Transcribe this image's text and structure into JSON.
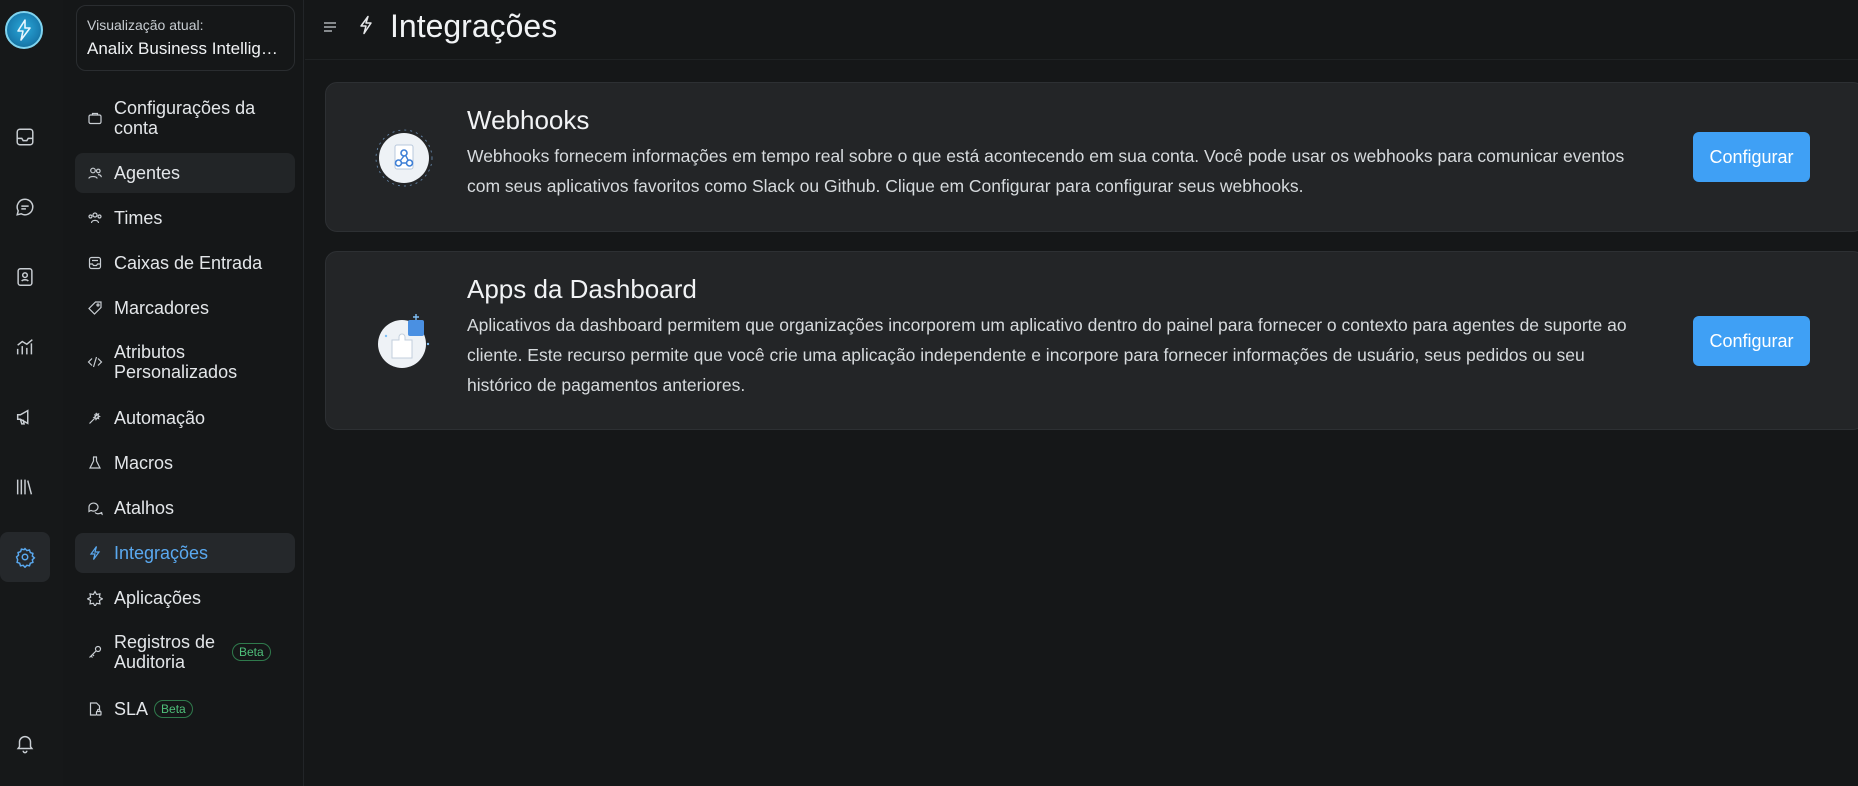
{
  "header": {
    "title": "Integrações"
  },
  "account": {
    "label": "Visualização atual:",
    "name": "Analix Business Intelligence"
  },
  "sidebar": {
    "items": [
      {
        "label": "Configurações da conta",
        "icon": "briefcase-icon"
      },
      {
        "label": "Agentes",
        "icon": "people-icon"
      },
      {
        "label": "Times",
        "icon": "team-icon"
      },
      {
        "label": "Caixas de Entrada",
        "icon": "mailbox-icon"
      },
      {
        "label": "Marcadores",
        "icon": "tag-icon"
      },
      {
        "label": "Atributos Personalizados",
        "icon": "code-icon"
      },
      {
        "label": "Automação",
        "icon": "automation-icon"
      },
      {
        "label": "Macros",
        "icon": "flask-icon"
      },
      {
        "label": "Atalhos",
        "icon": "chat-bubbles-icon"
      },
      {
        "label": "Integrações",
        "icon": "bolt-icon"
      },
      {
        "label": "Aplicações",
        "icon": "puzzle-icon"
      },
      {
        "label": "Registros de Auditoria",
        "icon": "key-icon",
        "badge": "Beta"
      },
      {
        "label": "SLA",
        "icon": "document-lock-icon",
        "badge": "Beta"
      }
    ],
    "active_label": "Integrações"
  },
  "cards": [
    {
      "title": "Webhooks",
      "description": "Webhooks fornecem informações em tempo real sobre o que está acontecendo em sua conta. Você pode usar os webhooks para comunicar eventos com seus aplicativos favoritos como Slack ou Github. Clique em Configurar para configurar seus webhooks.",
      "button": "Configurar"
    },
    {
      "title": "Apps da Dashboard",
      "description": "Aplicativos da dashboard permitem que organizações incorporem um aplicativo dentro do painel para fornecer o contexto para agentes de suporte ao cliente. Este recurso permite que você crie uma aplicação independente e incorpore para fornecer informações de usuário, seus pedidos ou seu histórico de pagamentos anteriores.",
      "button": "Configurar"
    }
  ],
  "colors": {
    "accent": "#3fa0f5",
    "active_text": "#5aa9f0",
    "beta": "#4fbf7a",
    "background": "#151718",
    "card": "#232527"
  }
}
